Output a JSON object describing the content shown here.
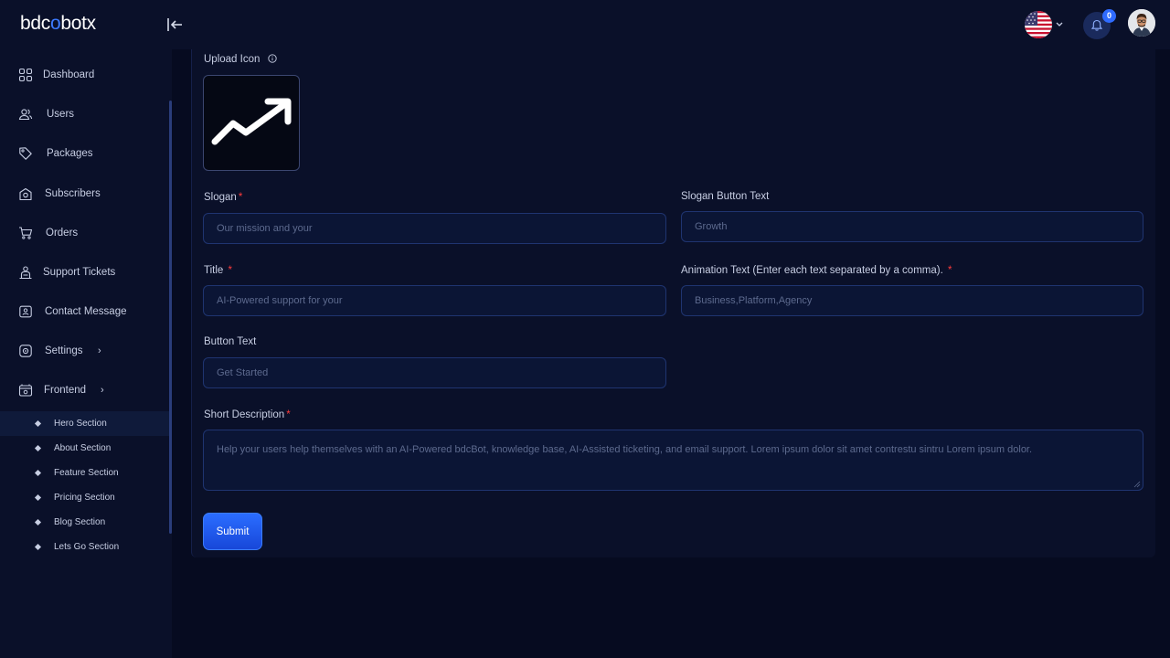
{
  "app": {
    "logo_prefix": "bdc",
    "logo_o": "o",
    "logo_suffix": "botx"
  },
  "header": {
    "notification_count": "0",
    "language": "en-US"
  },
  "sidebar": {
    "items": [
      {
        "label": "Dashboard",
        "icon": "dashboard-grid-icon"
      },
      {
        "label": "Users",
        "icon": "users-icon"
      },
      {
        "label": "Packages",
        "icon": "tag-icon"
      },
      {
        "label": "Subscribers",
        "icon": "subscribers-icon"
      },
      {
        "label": "Orders",
        "icon": "cart-icon"
      },
      {
        "label": "Support Tickets",
        "icon": "support-icon"
      },
      {
        "label": "Contact Message",
        "icon": "contact-icon"
      },
      {
        "label": "Settings",
        "icon": "settings-icon",
        "has_submenu": true
      },
      {
        "label": "Frontend",
        "icon": "frontend-icon",
        "has_submenu": true
      }
    ],
    "subitems": [
      {
        "label": "Hero Section",
        "active": true
      },
      {
        "label": "About Section"
      },
      {
        "label": "Feature Section"
      },
      {
        "label": "Pricing Section"
      },
      {
        "label": "Blog Section"
      },
      {
        "label": "Lets Go Section"
      }
    ]
  },
  "form": {
    "upload_icon_label": "Upload Icon",
    "slogan": {
      "label": "Slogan",
      "required": "*",
      "placeholder": "Our mission and your"
    },
    "slogan_button": {
      "label": "Slogan Button Text",
      "placeholder": "Growth"
    },
    "title": {
      "label": "Title",
      "required": "*",
      "placeholder": "AI-Powered support for your"
    },
    "animation": {
      "label": "Animation Text (Enter each text separated by a comma).",
      "required": "*",
      "placeholder": "Business,Platform,Agency"
    },
    "button_text": {
      "label": "Button Text",
      "placeholder": "Get Started"
    },
    "short_description": {
      "label": "Short Description",
      "required": "*",
      "placeholder": "Help your users help themselves with an AI-Powered bdcBot, knowledge base, AI-Assisted ticketing, and email support. Lorem ipsum dolor sit amet contrestu sintru Lorem ipsum dolor."
    },
    "submit_label": "Submit"
  },
  "colors": {
    "accent": "#2f6bff",
    "required": "#ff3b3b",
    "background": "#060b20",
    "panel": "#0a1029"
  }
}
